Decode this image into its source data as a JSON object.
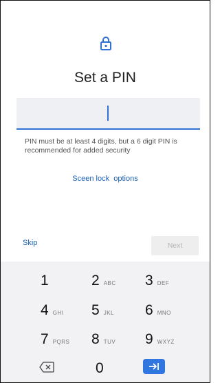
{
  "screen": {
    "title": "Set a PIN",
    "hint": "PIN must be at least 4 digits, but a 6 digit PIN is recommended for added security",
    "options_link": "Sceen lock  options",
    "skip_label": "Skip",
    "next_label": "Next"
  },
  "icons": {
    "lock": "lock-icon",
    "backspace": "backspace-icon",
    "go": "tab-arrow-icon"
  },
  "colors": {
    "accent": "#2f6fd6",
    "link": "#1a5fb4"
  },
  "keypad": {
    "keys": [
      {
        "digit": "1",
        "letters": ""
      },
      {
        "digit": "2",
        "letters": "ABC"
      },
      {
        "digit": "3",
        "letters": "DEF"
      },
      {
        "digit": "4",
        "letters": "GHI"
      },
      {
        "digit": "5",
        "letters": "JKL"
      },
      {
        "digit": "6",
        "letters": "MNO"
      },
      {
        "digit": "7",
        "letters": "PQRS"
      },
      {
        "digit": "8",
        "letters": "TUV"
      },
      {
        "digit": "9",
        "letters": "WXYZ"
      },
      {
        "digit": "0",
        "letters": ""
      }
    ]
  }
}
